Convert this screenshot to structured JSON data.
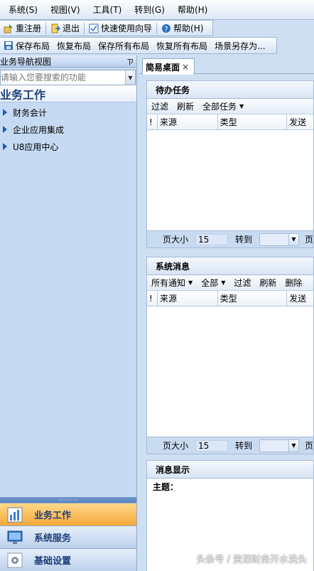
{
  "menubar": {
    "items": [
      "系统(S)",
      "视图(V)",
      "工具(T)",
      "转到(G)",
      "帮助(H)"
    ]
  },
  "toolbar1": {
    "items": [
      {
        "label": "重注册",
        "icon": "relogin-icon"
      },
      {
        "label": "退出",
        "icon": "exit-icon"
      },
      {
        "label": "快速使用向导",
        "icon": "wizard-icon"
      },
      {
        "label": "帮助(H)",
        "icon": "help-icon"
      }
    ]
  },
  "toolbar2": {
    "items": [
      "保存布局",
      "恢复布局",
      "保存所有布局",
      "恢复所有布局",
      "场景另存为..."
    ]
  },
  "nav": {
    "title": "业务导航视图",
    "pin": "ㄗ",
    "search_placeholder": "请输入您要搜索的功能",
    "heading": "业务工作",
    "items": [
      "财务会计",
      "企业应用集成",
      "U8应用中心"
    ],
    "grip": "········",
    "bottom": [
      {
        "label": "业务工作",
        "active": true
      },
      {
        "label": "系统服务",
        "active": false
      },
      {
        "label": "基础设置",
        "active": false
      }
    ]
  },
  "tab": {
    "label": "简易桌面",
    "close": "×"
  },
  "todo": {
    "title": "待办任务",
    "tools": [
      "过滤",
      "刷新",
      "全部任务"
    ],
    "columns": [
      "!",
      "来源",
      "类型",
      "发送"
    ],
    "pager": {
      "size_label": "页大小",
      "size_value": "15",
      "goto_label": "转到",
      "page_label": "页"
    }
  },
  "sysmsg": {
    "title": "系统消息",
    "tools": [
      "所有通知",
      "全部",
      "过滤",
      "刷新",
      "删除"
    ],
    "columns": [
      "!",
      "来源",
      "类型",
      "发送"
    ],
    "pager": {
      "size_label": "页大小",
      "size_value": "15",
      "goto_label": "转到",
      "page_label": "页"
    }
  },
  "msgshow": {
    "title": "消息显示",
    "subject_label": "主题："
  },
  "watermark": "头条号 / 资深财务开水洗头"
}
